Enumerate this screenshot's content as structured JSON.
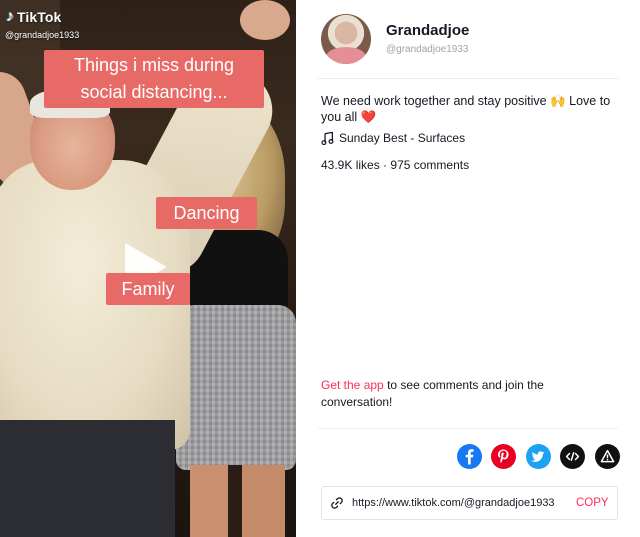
{
  "video": {
    "brand_name": "TikTok",
    "handle": "@grandadjoe1933",
    "captions": {
      "title": "Things i miss during social distancing...",
      "dancing": "Dancing",
      "family": "Family"
    },
    "play_icon": "play-icon"
  },
  "profile": {
    "display_name": "Grandadjoe",
    "username": "@grandadjoe1933"
  },
  "post": {
    "description_text": "We need work together and stay positive",
    "description_emoji_hands": "🙌",
    "description_tail": "Love to you all",
    "description_emoji_heart": "❤️",
    "music_icon": "music-note-icon",
    "music": "Sunday Best - Surfaces",
    "likes": "43.9K likes",
    "stats_separator": "·",
    "comments": "975 comments"
  },
  "cta": {
    "link_text": "Get the app",
    "rest_text": "to see comments and join the conversation!"
  },
  "share": {
    "icons": [
      "facebook-icon",
      "pinterest-icon",
      "twitter-icon",
      "embed-icon",
      "report-icon"
    ]
  },
  "link": {
    "url": "https://www.tiktok.com/@grandadjoe1933",
    "copy_label": "COPY"
  },
  "colors": {
    "accent": "#fe2c55",
    "caption_bg": "#e86a66",
    "facebook": "#1877f2",
    "pinterest": "#e60023",
    "twitter": "#1da1f2"
  }
}
